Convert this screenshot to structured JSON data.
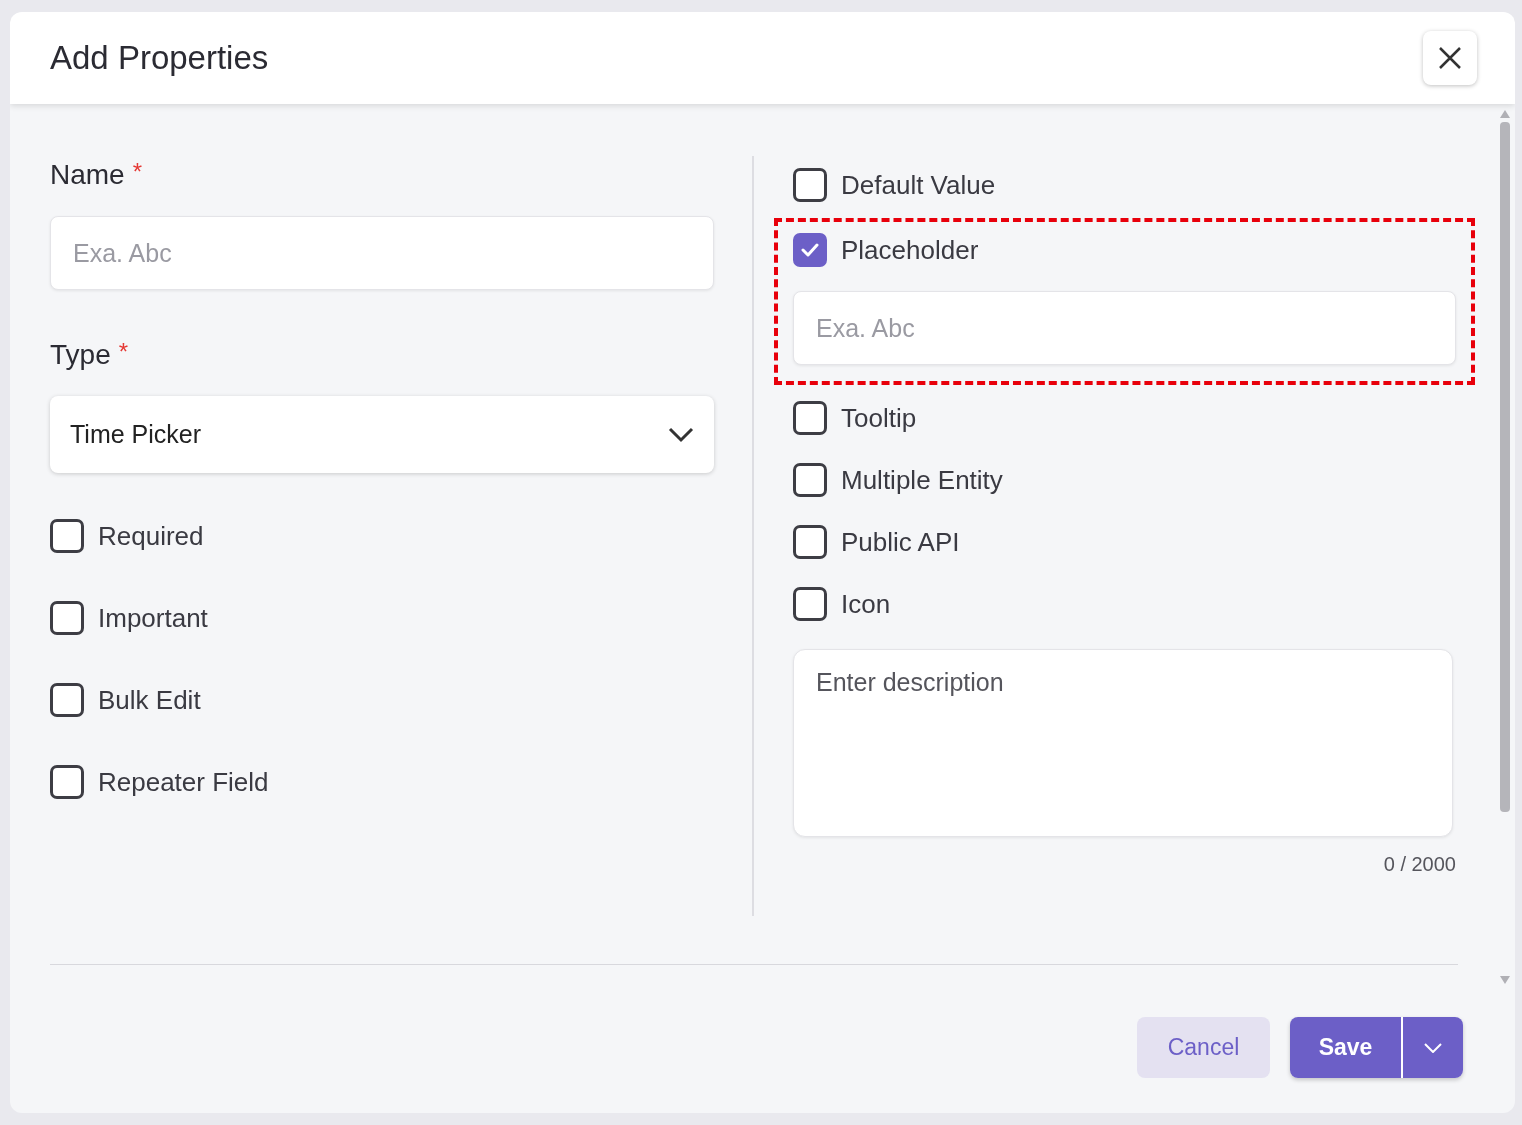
{
  "dialog": {
    "title": "Add Properties"
  },
  "left": {
    "fields": [
      {
        "kind": "input",
        "label": "Name",
        "required_mark": "*",
        "placeholder": "Exa. Abc"
      },
      {
        "kind": "select",
        "label": "Type",
        "required_mark": "*",
        "value": "Time Picker"
      }
    ],
    "checkboxes": [
      {
        "label": "Required",
        "checked": false
      },
      {
        "label": "Important",
        "checked": false
      },
      {
        "label": "Bulk Edit",
        "checked": false
      },
      {
        "label": "Repeater Field",
        "checked": false
      }
    ]
  },
  "right": {
    "options": [
      {
        "label": "Default Value",
        "checked": false,
        "highlighted": false
      },
      {
        "label": "Placeholder",
        "checked": true,
        "highlighted": true,
        "input": {
          "placeholder": "Exa. Abc"
        }
      },
      {
        "label": "Tooltip",
        "checked": false,
        "highlighted": false
      },
      {
        "label": "Multiple Entity",
        "checked": false,
        "highlighted": false
      },
      {
        "label": "Public API",
        "checked": false,
        "highlighted": false
      },
      {
        "label": "Icon",
        "checked": false,
        "highlighted": false
      }
    ],
    "description": {
      "placeholder": "Enter description",
      "counter": "0 / 2000"
    }
  },
  "buttons": {
    "cancel": "Cancel",
    "save": "Save"
  }
}
